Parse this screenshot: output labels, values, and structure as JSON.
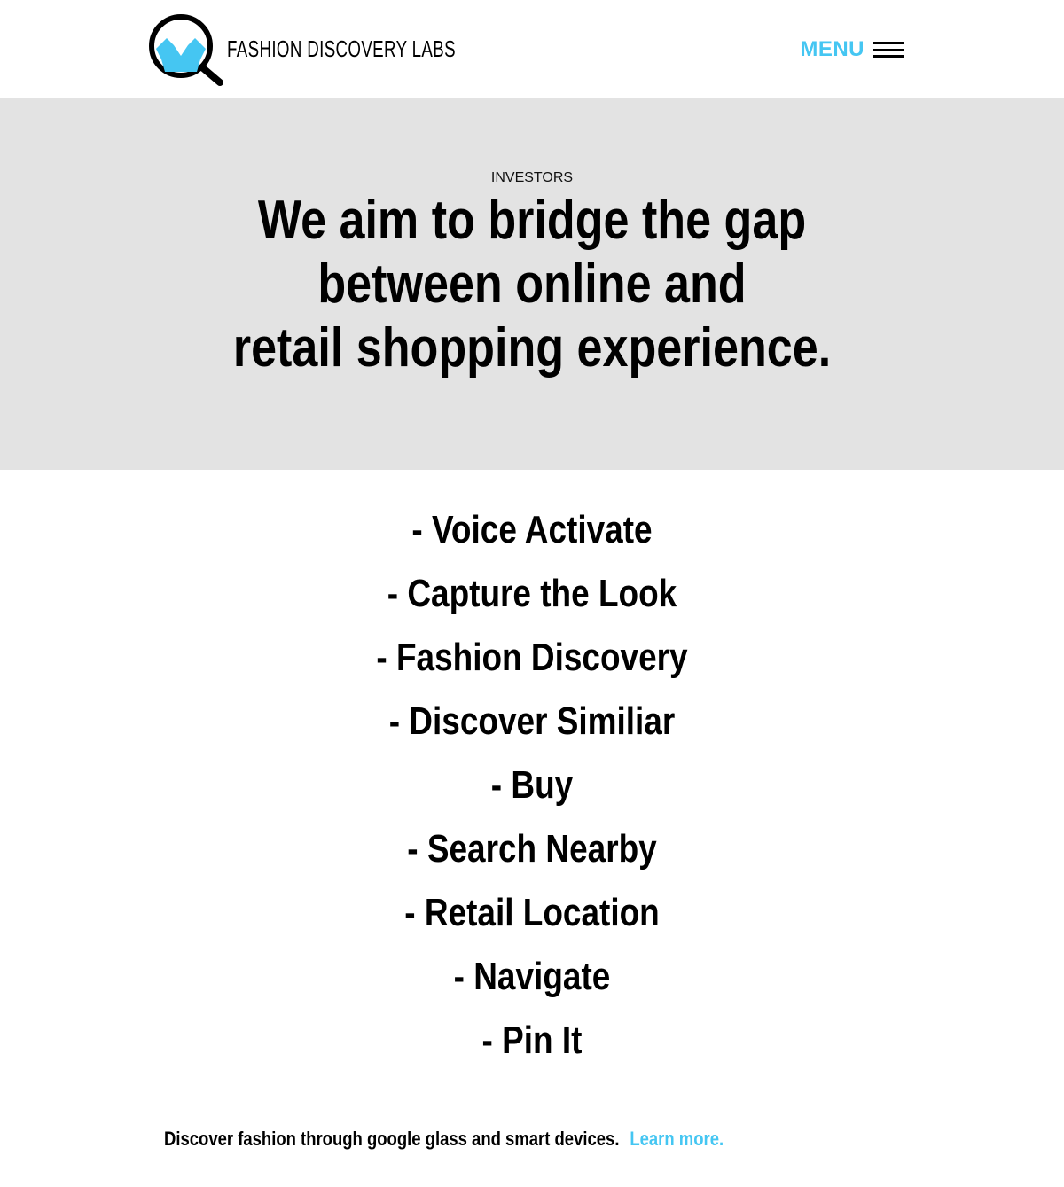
{
  "header": {
    "logo_text": "FASHION DISCOVERY LABS",
    "menu_label": "MENU"
  },
  "hero": {
    "eyebrow": "INVESTORS",
    "headline_lines": [
      "We aim to bridge the gap",
      "between online and",
      "retail shopping experience."
    ]
  },
  "features": [
    "- Voice Activate",
    "- Capture the Look",
    "- Fashion Discovery",
    "- Discover Similiar",
    "- Buy",
    "- Search Nearby",
    "- Retail Location",
    "- Navigate",
    "- Pin It"
  ],
  "footer": {
    "text": "Discover fashion through google glass and smart devices.",
    "link_label": "Learn more."
  },
  "colors": {
    "accent": "#45c6f2",
    "hero_bg": "#e3e3e3",
    "text": "#000000"
  },
  "icons": {
    "logo": "magnifier-shirt-icon",
    "menu": "hamburger-icon"
  }
}
